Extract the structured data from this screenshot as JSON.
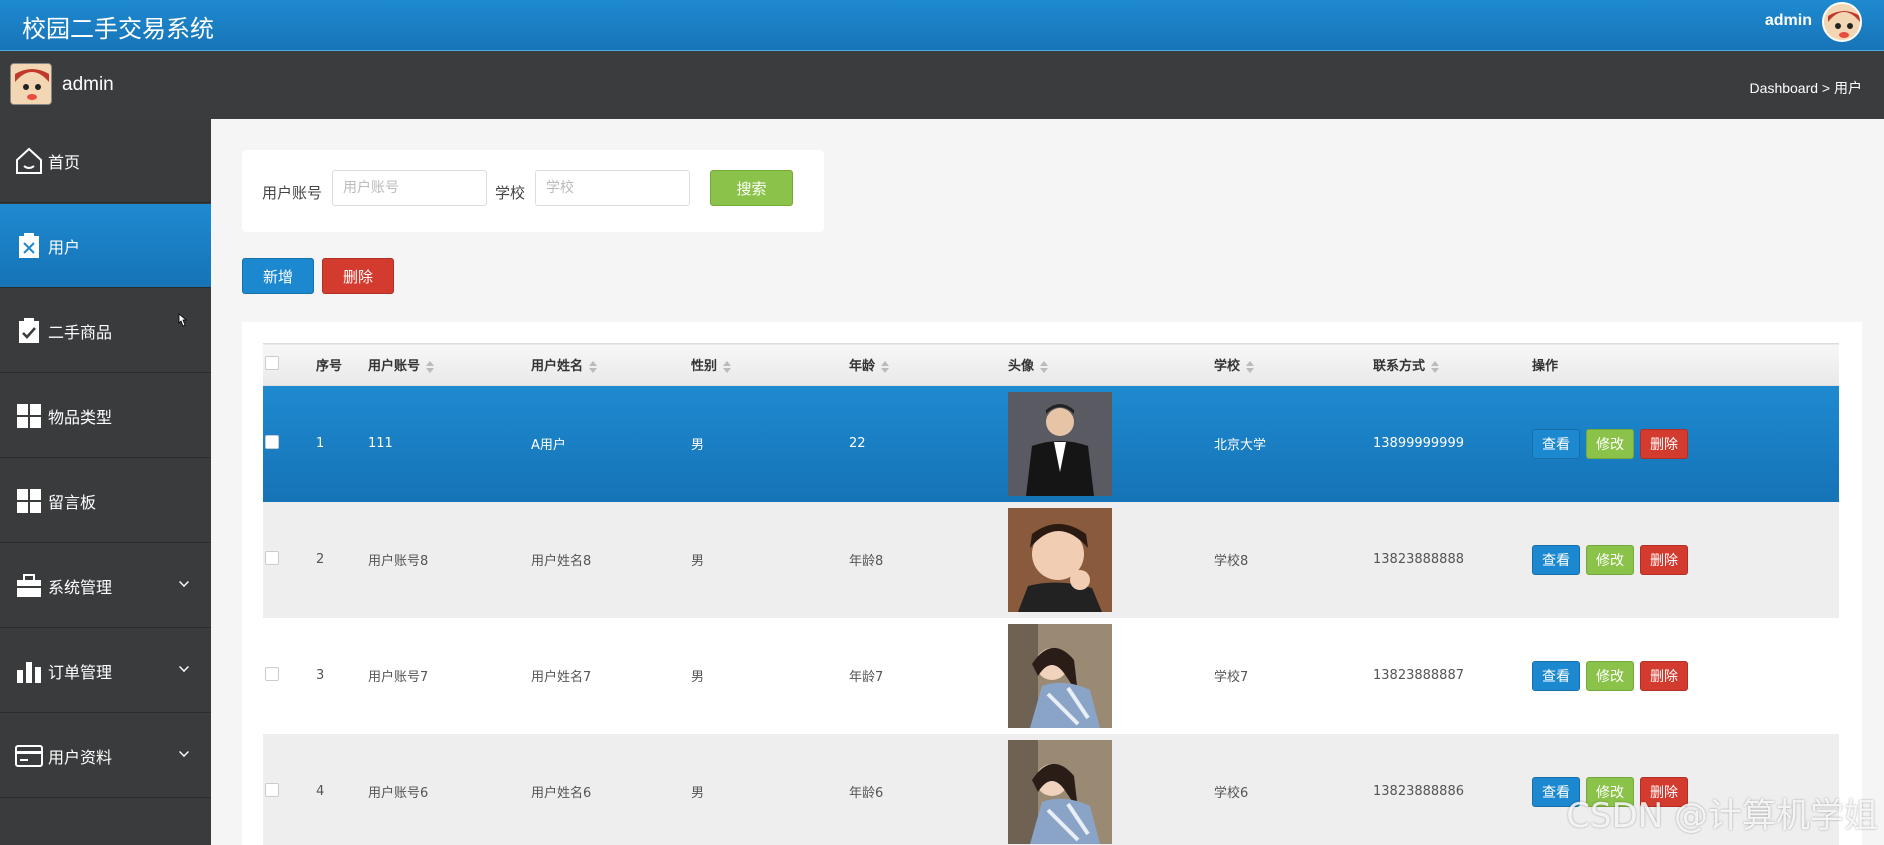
{
  "header": {
    "app_title": "校园二手交易系统",
    "user_name": "admin"
  },
  "subheader": {
    "user_name": "admin",
    "breadcrumb": "Dashboard > 用户"
  },
  "sidebar": {
    "items": [
      {
        "label": "首页",
        "icon": "home-icon",
        "active": false,
        "expandable": false
      },
      {
        "label": "用户",
        "icon": "clipboard-x-icon",
        "active": true,
        "expandable": false
      },
      {
        "label": "二手商品",
        "icon": "clipboard-check-icon",
        "active": false,
        "expandable": false
      },
      {
        "label": "物品类型",
        "icon": "grid-icon",
        "active": false,
        "expandable": false
      },
      {
        "label": "留言板",
        "icon": "grid-icon",
        "active": false,
        "expandable": false
      },
      {
        "label": "系统管理",
        "icon": "briefcase-icon",
        "active": false,
        "expandable": true
      },
      {
        "label": "订单管理",
        "icon": "bar-chart-icon",
        "active": false,
        "expandable": true
      },
      {
        "label": "用户资料",
        "icon": "card-icon",
        "active": false,
        "expandable": true
      }
    ]
  },
  "search": {
    "account_label": "用户账号",
    "account_placeholder": "用户账号",
    "school_label": "学校",
    "school_placeholder": "学校",
    "search_button": "搜索"
  },
  "actions": {
    "add_button": "新增",
    "delete_button": "删除"
  },
  "table": {
    "columns": [
      "序号",
      "用户账号",
      "用户姓名",
      "性别",
      "年龄",
      "头像",
      "学校",
      "联系方式",
      "操作"
    ],
    "rows": [
      {
        "no": "1",
        "account": "111",
        "name": "A用户",
        "gender": "男",
        "age": "22",
        "avatar": "photo-man-suit",
        "school": "北京大学",
        "phone": "13899999999",
        "row_style": "selected"
      },
      {
        "no": "2",
        "account": "用户账号8",
        "name": "用户姓名8",
        "gender": "男",
        "age": "年龄8",
        "avatar": "photo-young-man",
        "school": "学校8",
        "phone": "13823888888",
        "row_style": "alt"
      },
      {
        "no": "3",
        "account": "用户账号7",
        "name": "用户姓名7",
        "gender": "男",
        "age": "年龄7",
        "avatar": "photo-girl",
        "school": "学校7",
        "phone": "13823888887",
        "row_style": "plain"
      },
      {
        "no": "4",
        "account": "用户账号6",
        "name": "用户姓名6",
        "gender": "男",
        "age": "年龄6",
        "avatar": "photo-girl",
        "school": "学校6",
        "phone": "13823888886",
        "row_style": "alt"
      }
    ],
    "op_view": "查看",
    "op_edit": "修改",
    "op_delete": "删除"
  },
  "watermark": "CSDN @计算机学姐",
  "colors": {
    "primary": "#1c88cf",
    "success": "#8bc34a",
    "danger": "#d33b2f",
    "sidebar_bg": "#3a3b3d"
  }
}
